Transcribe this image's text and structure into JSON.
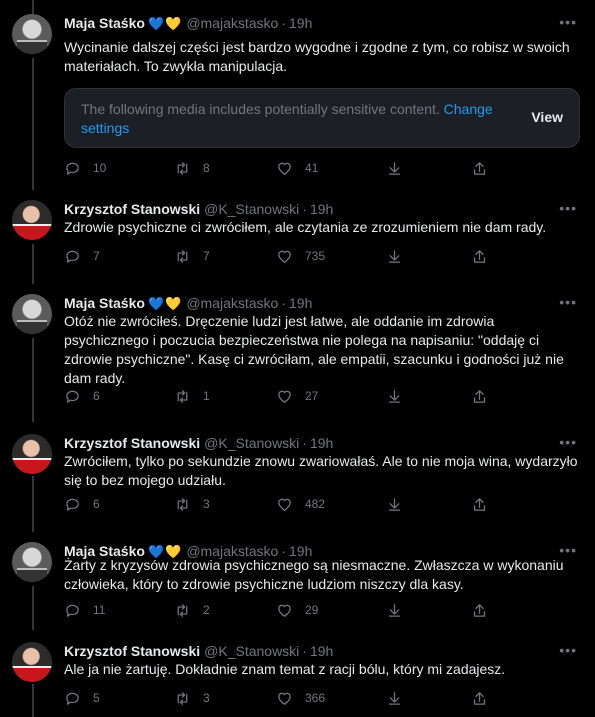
{
  "tweets": [
    {
      "name": "Maja Staśko",
      "emoji": [
        "💙",
        "💛"
      ],
      "handle": "@majakstasko",
      "time": "19h",
      "text": "Wycinanie dalszej części jest bardzo wygodne i zgodne z tym, co robisz w swoich materiałach. To zwykła manipulacja.",
      "sensitive": {
        "text": "The following media includes potentially sensitive content.",
        "link": "Change settings",
        "button": "View"
      },
      "replies": "10",
      "retweets": "8",
      "likes": "41"
    },
    {
      "name": "Krzysztof Stanowski",
      "handle": "@K_Stanowski",
      "time": "19h",
      "text": "Zdrowie psychiczne ci zwróciłem, ale czytania ze zrozumieniem nie dam rady.",
      "replies": "7",
      "retweets": "7",
      "likes": "735"
    },
    {
      "name": "Maja Staśko",
      "emoji": [
        "💙",
        "💛"
      ],
      "handle": "@majakstasko",
      "time": "19h",
      "text": "Otóż nie zwróciłeś. Dręczenie ludzi jest łatwe, ale oddanie im zdrowia psychicznego i poczucia bezpieczeństwa nie polega na napisaniu: \"oddaję ci zdrowie psychiczne\". Kasę ci zwróciłam, ale empatii, szacunku i godności już nie dam rady.",
      "replies": "6",
      "retweets": "1",
      "likes": "27"
    },
    {
      "name": "Krzysztof Stanowski",
      "handle": "@K_Stanowski",
      "time": "19h",
      "text": "Zwróciłem, tylko po sekundzie znowu zwariowałaś. Ale to nie moja wina, wydarzyło się to bez mojego udziału.",
      "replies": "6",
      "retweets": "3",
      "likes": "482"
    },
    {
      "name": "Maja Staśko",
      "emoji": [
        "💙",
        "💛"
      ],
      "handle": "@majakstasko",
      "time": "19h",
      "text": "Żarty z kryzysów zdrowia psychicznego są niesmaczne. Zwłaszcza w wykonaniu człowieka, który to zdrowie psychiczne ludziom niszczy dla kasy.",
      "replies": "11",
      "retweets": "2",
      "likes": "29"
    },
    {
      "name": "Krzysztof Stanowski",
      "handle": "@K_Stanowski",
      "time": "19h",
      "text": "Ale ja nie żartuję. Dokładnie znam temat z racji bólu, który mi zadajesz.",
      "replies": "5",
      "retweets": "3",
      "likes": "366"
    }
  ],
  "icons": {
    "more": "more-icon",
    "reply": "reply-icon",
    "retweet": "retweet-icon",
    "like": "heart-icon",
    "share": "share-icon"
  }
}
